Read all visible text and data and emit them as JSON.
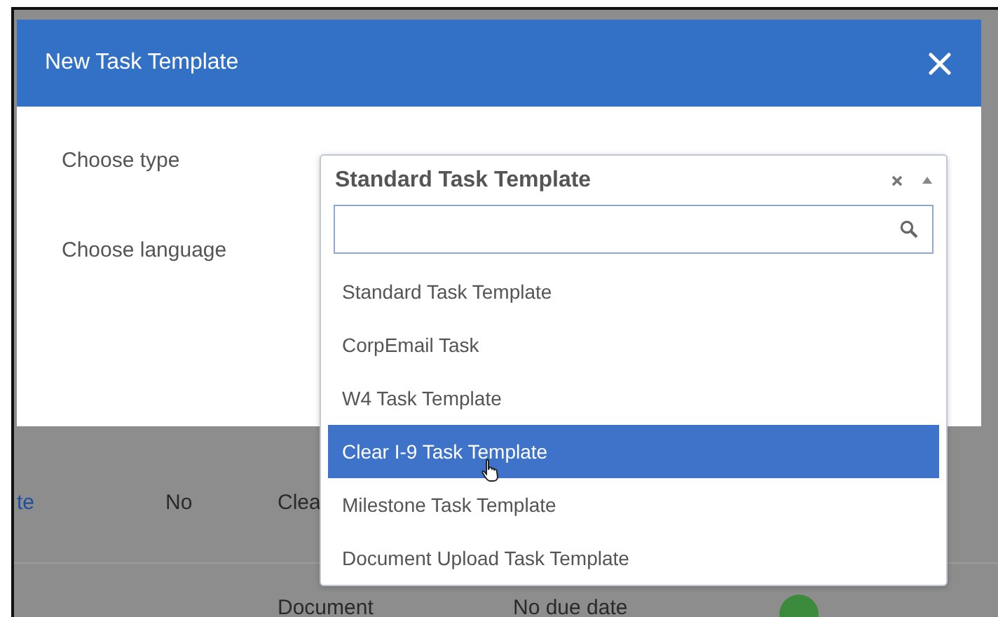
{
  "dialog": {
    "title": "New Task Template",
    "fields": [
      {
        "label": "Choose type",
        "value": "Standard Task Template"
      },
      {
        "label": "Choose language"
      }
    ]
  },
  "dropdown": {
    "options": [
      {
        "label": "Standard Task Template",
        "selected": false
      },
      {
        "label": "CorpEmail Task",
        "selected": false
      },
      {
        "label": "W4 Task Template",
        "selected": false
      },
      {
        "label": "Clear I-9 Task Template",
        "selected": true
      },
      {
        "label": "Milestone Task Template",
        "selected": false
      },
      {
        "label": "Document Upload Task Template",
        "selected": false
      }
    ]
  },
  "background_table": {
    "rows": [
      {
        "column_1": "te",
        "column_2": "No",
        "column_3": "Clea"
      },
      {
        "column_3": "Document",
        "column_4": "No due date"
      }
    ]
  }
}
